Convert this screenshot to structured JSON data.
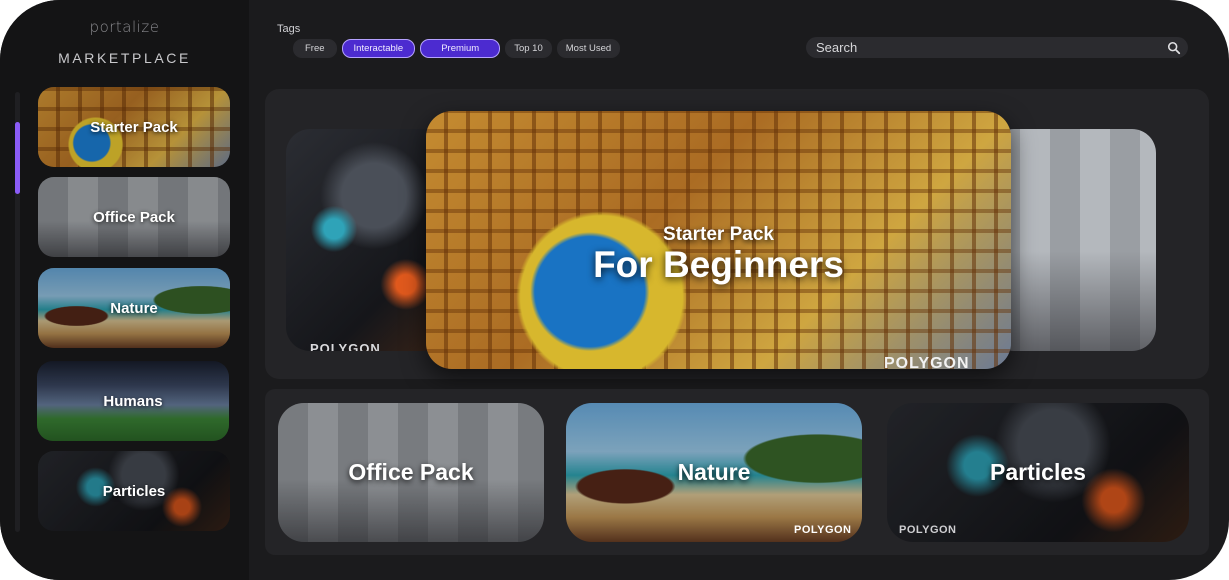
{
  "brand": {
    "logo_text": "portalize",
    "section_title": "MARKETPLACE"
  },
  "sidebar": {
    "items": [
      {
        "label": "Starter Pack",
        "scene": "starter"
      },
      {
        "label": "Office Pack",
        "scene": "office"
      },
      {
        "label": "Nature",
        "scene": "nature"
      },
      {
        "label": "Humans",
        "scene": "humans"
      },
      {
        "label": "Particles",
        "scene": "particles"
      }
    ]
  },
  "tags": {
    "title": "Tags",
    "chips": [
      {
        "label": "Free",
        "active": false
      },
      {
        "label": "Interactable",
        "active": true
      },
      {
        "label": "Premium",
        "active": true
      },
      {
        "label": "Top 10",
        "active": false
      },
      {
        "label": "Most Used",
        "active": false
      }
    ]
  },
  "search": {
    "placeholder": "Search",
    "icon": "search-icon"
  },
  "hero": {
    "subtitle": "Starter Pack",
    "title": "For Beginners",
    "left_watermark": "POLYGON",
    "main_watermark": "POLYGON"
  },
  "cards": [
    {
      "label": "Office Pack",
      "scene": "office"
    },
    {
      "label": "Nature",
      "scene": "nature",
      "watermark": "POLYGON"
    },
    {
      "label": "Particles",
      "scene": "particles",
      "watermark": "POLYGON"
    }
  ],
  "colors": {
    "accent": "#8b5cf6",
    "chip_active": "#4c2bd0",
    "panel": "#242427",
    "background": "#1b1b1d"
  }
}
